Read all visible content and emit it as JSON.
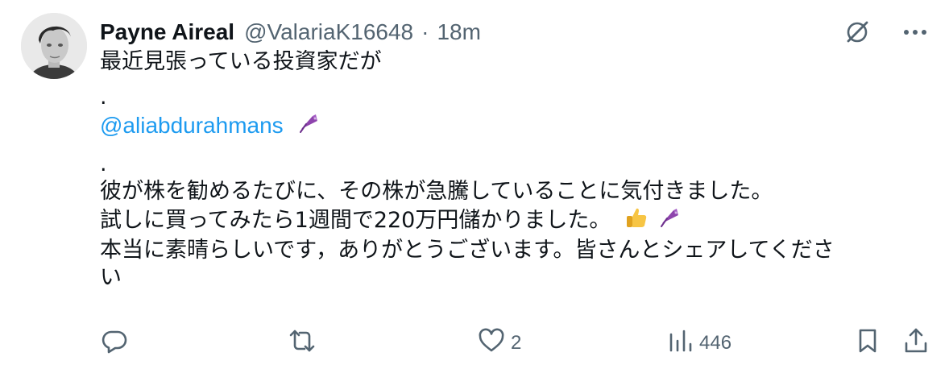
{
  "author": {
    "name": "Payne Aireal",
    "handle": "@ValariaK16648",
    "separator": "·",
    "time": "18m"
  },
  "post": {
    "line1": "最近見張っている投資家だが",
    "dot1": ".",
    "mention": "@aliabdurahmans",
    "dot2": ".",
    "line2": "彼が株を勧めるたびに、その株が急騰していることに気付きました。",
    "line3": "試しに買ってみたら1週間で220万円儲かりました。",
    "line4": "本当に素晴らしいです，ありがとうございます。皆さんとシェアしてくださ",
    "line5": "い"
  },
  "actions": {
    "replies": "",
    "reposts": "",
    "likes": "2",
    "views": "446"
  },
  "icons": {
    "top": [
      "grok-icon",
      "more-icon"
    ],
    "actions": [
      "reply-icon",
      "repost-icon",
      "like-icon",
      "views-icon",
      "bookmark-icon",
      "share-icon"
    ],
    "emoji": [
      "umbrella-emoji",
      "thumbs-up-emoji"
    ]
  },
  "colors": {
    "text": "#0f1419",
    "secondary": "#536471",
    "link": "#1d9bf0"
  }
}
